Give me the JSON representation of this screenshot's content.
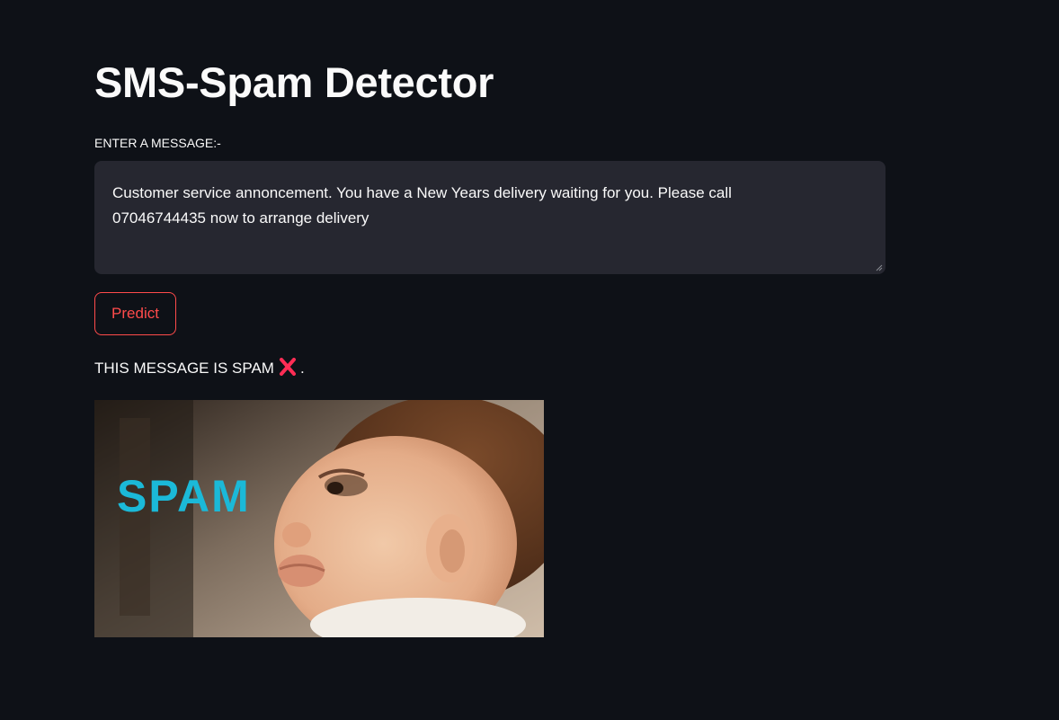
{
  "app": {
    "title": "SMS-Spam Detector"
  },
  "input": {
    "label": "ENTER A MESSAGE:-",
    "value": "Customer service annoncement. You have a New Years delivery waiting for you. Please call\n07046744435 now to arrange delivery"
  },
  "predict_button": {
    "label": "Predict",
    "color": "#ff4b4b"
  },
  "result": {
    "text_before": "THIS MESSAGE IS SPAM",
    "icon": "cross-mark-icon",
    "text_after": ".",
    "icon_color": "#ff2d55"
  },
  "image": {
    "overlay_text": "SPAM",
    "overlay_color": "#1bb9d8"
  },
  "theme": {
    "background": "#0e1117",
    "input_background": "#262730",
    "text": "#fafafa"
  }
}
